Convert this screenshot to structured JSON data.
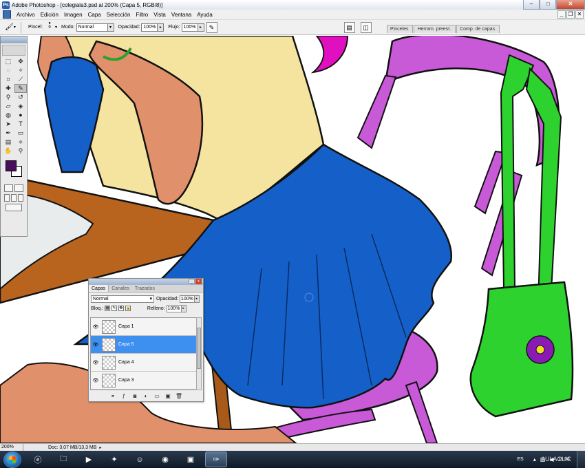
{
  "window": {
    "title": "Adobe Photoshop - [colegiala3.psd al 200% (Capa 5, RGB/8)]",
    "app_icon": "Ps",
    "controls": [
      "–",
      "□",
      "✕"
    ]
  },
  "menu": {
    "items": [
      "Archivo",
      "Edición",
      "Imagen",
      "Capa",
      "Selección",
      "Filtro",
      "Vista",
      "Ventana",
      "Ayuda"
    ],
    "doc_controls": [
      "_",
      "❐",
      "✕"
    ]
  },
  "options": {
    "brush_label": "Pincel:",
    "brush_size": "9",
    "mode_label": "Modo:",
    "mode_value": "Normal",
    "opacity_label": "Opacidad:",
    "opacity_value": "100%",
    "flow_label": "Flujo:",
    "flow_value": "100%"
  },
  "well_tabs": [
    "Pinceles",
    "Herram. preest.",
    "Comp. de capas"
  ],
  "toolbox": {
    "foreground_color": "#4a0e5c",
    "background_color": "#ffffff"
  },
  "layers_panel": {
    "tabs": [
      "Capas",
      "Canales",
      "Trazados"
    ],
    "blend_mode": "Normal",
    "opacity_label": "Opacidad:",
    "opacity_value": "100%",
    "lock_label": "Bloq.:",
    "fill_label": "Relleno:",
    "fill_value": "100%",
    "layers": [
      {
        "name": "Capa 1",
        "selected": false
      },
      {
        "name": "Capa 5",
        "selected": true
      },
      {
        "name": "Capa 4",
        "selected": false
      },
      {
        "name": "Capa 3",
        "selected": false
      }
    ]
  },
  "status": {
    "zoom": "200%",
    "doc_info": "Doc: 3,07 MB/13,3 MB"
  },
  "taskbar": {
    "language": "ES",
    "time": "18:04",
    "watermark": "AULACLIC"
  },
  "colors": {
    "skirt_blue": "#1560c8",
    "shirt_yellow": "#f4e4a0",
    "skin": "#e0906a",
    "chair_violet": "#c85ad8",
    "bag_green": "#2ed22e",
    "desk_brown": "#b8641e",
    "hair_magenta": "#e010c0",
    "selected_layer": "#3d8ff0"
  }
}
